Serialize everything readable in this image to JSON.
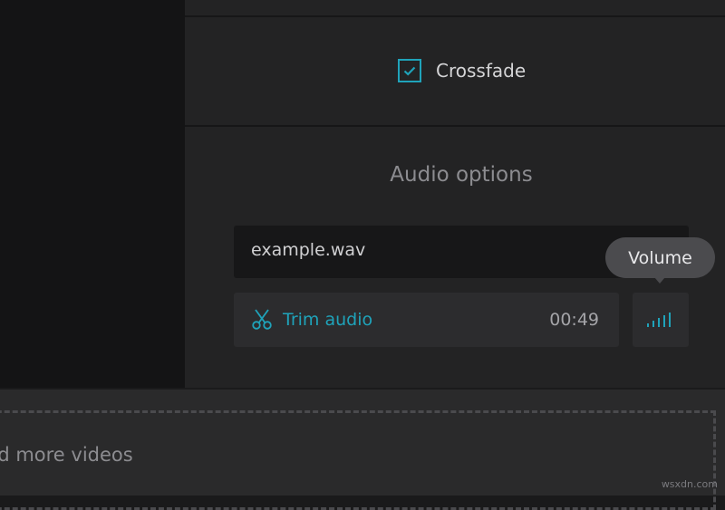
{
  "audio_settings": {
    "crossfade": {
      "label": "Crossfade",
      "checked": true
    },
    "section_title": "Audio options",
    "file": {
      "name": "example.wav"
    },
    "trim": {
      "label": "Trim audio",
      "duration": "00:49"
    },
    "volume": {
      "tooltip": "Volume",
      "icon": "volume-bars-icon"
    }
  },
  "dropzone": {
    "text": "Add more videos"
  },
  "watermark": "wsxdn.com",
  "colors": {
    "accent": "#1fa3ba",
    "panel": "#232324",
    "dark_panel": "#141415",
    "tooltip": "#4b4b4e"
  }
}
